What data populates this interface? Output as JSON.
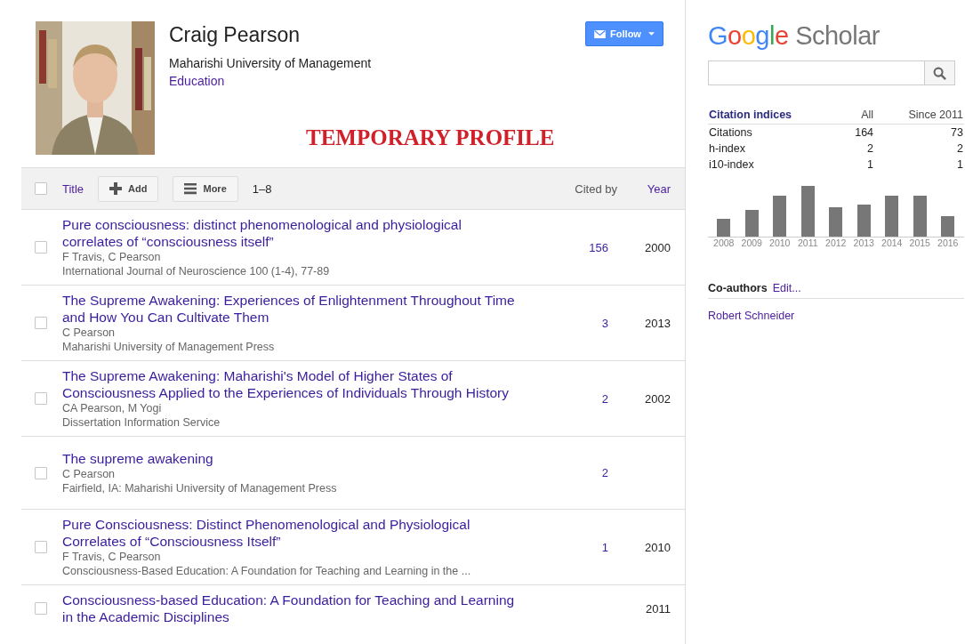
{
  "profile": {
    "name": "Craig Pearson",
    "affiliation": "Maharishi University of Management",
    "interest": "Education",
    "follow_button": "Follow",
    "banner": "TEMPORARY PROFILE"
  },
  "table": {
    "header": {
      "checked": false,
      "title": "Title",
      "add": "Add",
      "more": "More",
      "range": "1–8",
      "cited_by": "Cited by",
      "year": "Year"
    },
    "rows": [
      {
        "checked": false,
        "title": "Pure consciousness: distinct phenomenological and physiological correlates of “consciousness itself”",
        "authors": "F Travis, C Pearson",
        "venue": "International Journal of Neuroscience 100 (1-4), 77-89",
        "cited_by": "156",
        "year": "2000"
      },
      {
        "checked": false,
        "title": "The Supreme Awakening: Experiences of Enlightenment Throughout Time and How You Can Cultivate Them",
        "authors": "C Pearson",
        "venue": "Maharishi University of Management Press",
        "cited_by": "3",
        "year": "2013"
      },
      {
        "checked": false,
        "title": "The Supreme Awakening: Maharishi's Model of Higher States of Consciousness Applied to the Experiences of Individuals Through History",
        "authors": "CA Pearson, M Yogi",
        "venue": "Dissertation Information Service",
        "cited_by": "2",
        "year": "2002"
      },
      {
        "checked": false,
        "title": "The supreme awakening",
        "authors": "C Pearson",
        "venue": "Fairfield, IA: Maharishi University of Management Press",
        "cited_by": "2"
      },
      {
        "checked": false,
        "title": "Pure Consciousness: Distinct Phenomenological and Physiological Correlates of “Consciousness Itself”",
        "authors": "F Travis, C Pearson",
        "venue": "Consciousness-Based Education: A Foundation for Teaching and Learning in the ...",
        "cited_by": "1",
        "year": "2010"
      },
      {
        "checked": false,
        "title": "Consciousness-based Education: A Foundation for Teaching and Learning in the Academic Disciplines",
        "year": "2011"
      }
    ]
  },
  "sidebar": {
    "logo": {
      "google": "Google",
      "scholar": "Scholar"
    },
    "citation_indices": {
      "heading": "Citation indices",
      "col_all": "All",
      "col_since": "Since 2011",
      "rows": [
        {
          "label": "Citations",
          "all": "164",
          "since": "73"
        },
        {
          "label": "h-index",
          "all": "2",
          "since": "2"
        },
        {
          "label": "i10-index",
          "all": "1",
          "since": "1"
        }
      ]
    },
    "chart_years": [
      "2008",
      "2009",
      "2010",
      "2011",
      "2012",
      "2013",
      "2014",
      "2015",
      "2016"
    ],
    "coauthors": {
      "heading": "Co-authors",
      "edit": "Edit...",
      "items": [
        "Robert Schneider"
      ]
    }
  }
}
